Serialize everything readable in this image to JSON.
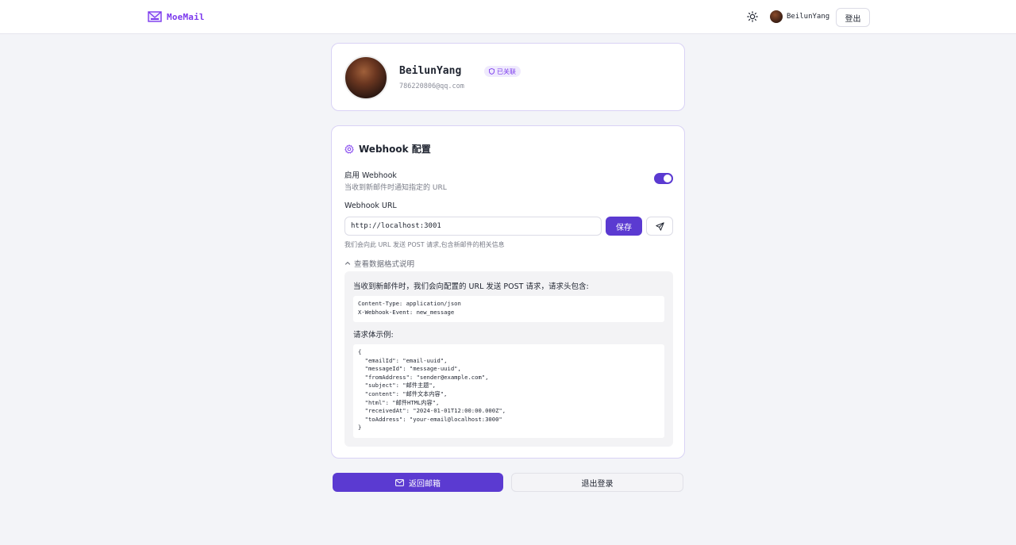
{
  "header": {
    "brand": "MoeMail",
    "user_name": "BeilunYang",
    "logout_label": "登出"
  },
  "profile": {
    "name": "BeilunYang",
    "badge": "已关联",
    "email": "786220806@qq.com"
  },
  "webhook": {
    "title": "Webhook 配置",
    "enable_label": "启用 Webhook",
    "enable_desc": "当收到新邮件时通知指定的 URL",
    "enabled": true,
    "url_label": "Webhook URL",
    "url_value": "http://localhost:3001",
    "save_label": "保存",
    "url_hint": "我们会向此 URL 发送 POST 请求,包含新邮件的相关信息",
    "docs_toggle": "查看数据格式说明",
    "docs_intro": "当收到新邮件时，我们会向配置的 URL 发送 POST 请求，请求头包含:",
    "headers_code": "Content-Type: application/json\nX-Webhook-Event: new_message",
    "body_label": "请求体示例:",
    "body_code": "{\n  \"emailId\": \"email-uuid\",\n  \"messageId\": \"message-uuid\",\n  \"fromAddress\": \"sender@example.com\",\n  \"subject\": \"邮件主题\",\n  \"content\": \"邮件文本内容\",\n  \"html\": \"邮件HTML内容\",\n  \"receivedAt\": \"2024-01-01T12:00:00.000Z\",\n  \"toAddress\": \"your-email@localhost:3000\"\n}"
  },
  "actions": {
    "back_label": "返回邮箱",
    "signout_label": "退出登录"
  },
  "colors": {
    "accent": "#5b3ad1",
    "brand": "#7c3aed"
  }
}
